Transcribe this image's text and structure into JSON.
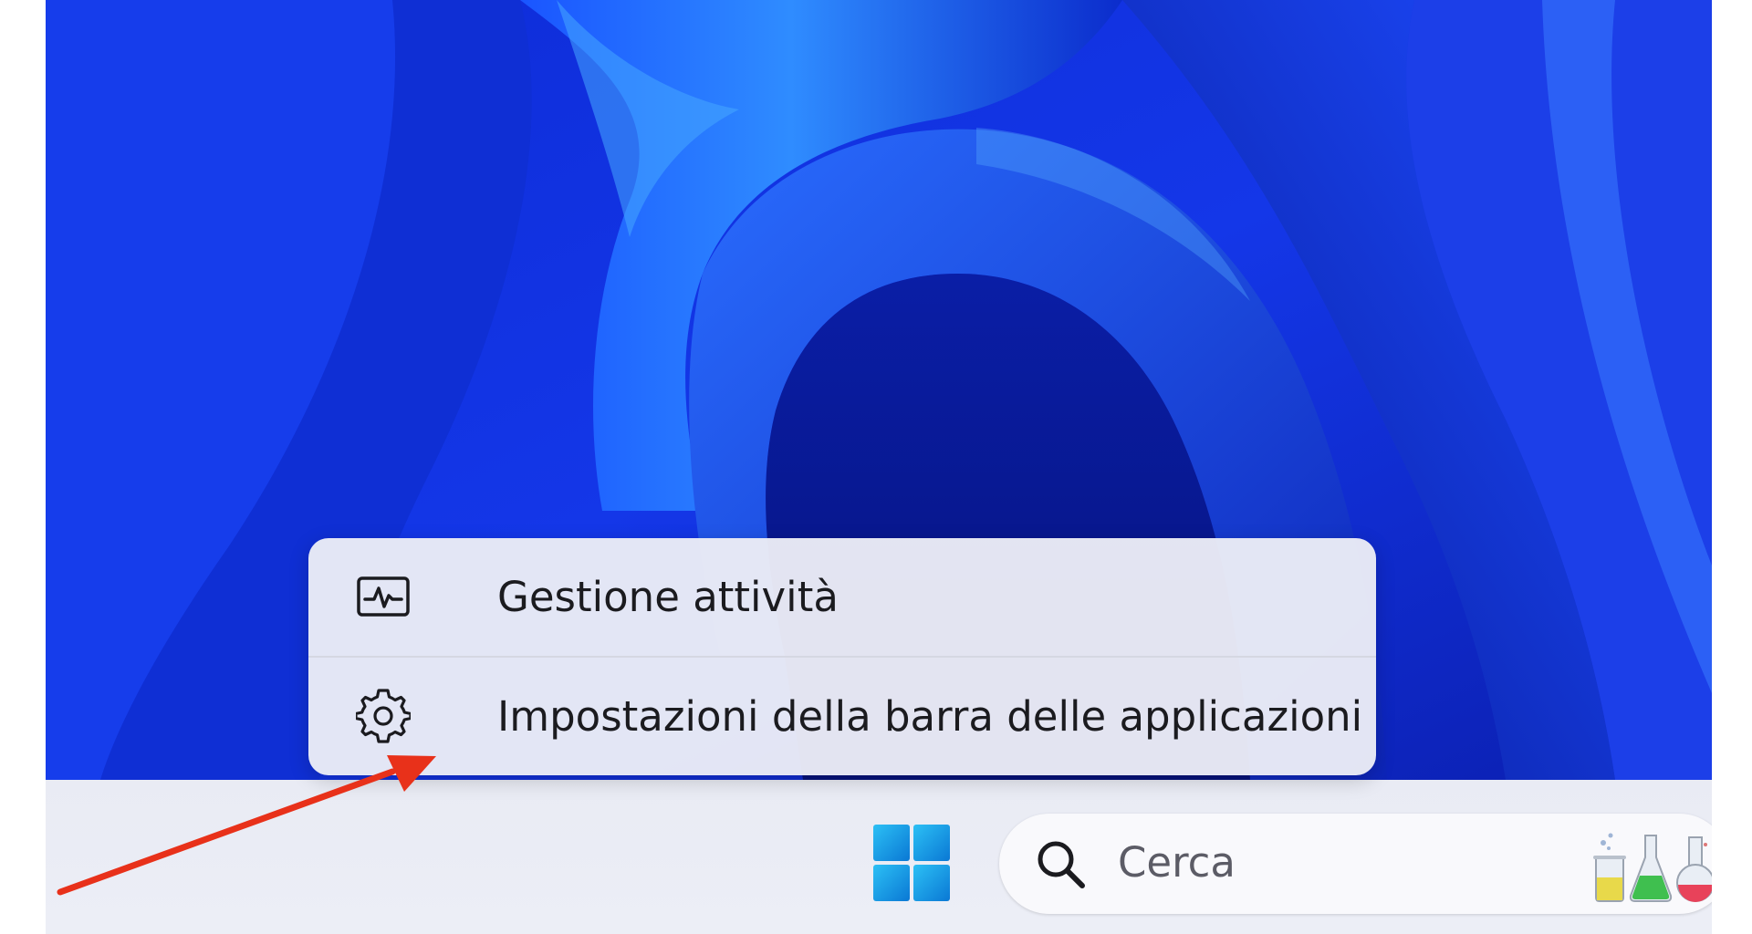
{
  "context_menu": {
    "items": [
      {
        "label": "Gestione attività",
        "icon": "task-manager-icon"
      },
      {
        "label": "Impostazioni della barra delle applicazioni",
        "icon": "gear-icon"
      }
    ]
  },
  "taskbar": {
    "start_icon": "windows-logo-icon",
    "search": {
      "placeholder": "Cerca",
      "icon": "search-icon",
      "highlight_icon": "science-lab-icon"
    }
  },
  "annotation": {
    "arrow_color": "#e8311a"
  },
  "colors": {
    "wallpaper_primary": "#1c3fe6",
    "wallpaper_dark": "#0a1a9c",
    "wallpaper_light": "#3f8cff",
    "taskbar": "#eceef6",
    "menu_background": "#ecedf6",
    "windows_logo": "#1e9de3"
  }
}
